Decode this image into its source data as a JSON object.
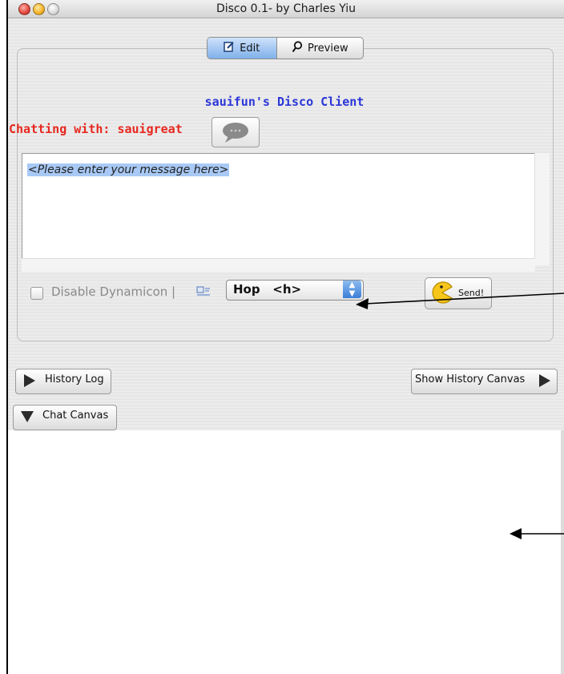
{
  "window": {
    "title": "Disco 0.1- by Charles Yiu"
  },
  "tabs": [
    {
      "label": "Edit",
      "icon": "edit-icon",
      "selected": true
    },
    {
      "label": "Preview",
      "icon": "magnifier-icon",
      "selected": false
    }
  ],
  "chat": {
    "client_title": "sauifun's Disco Client",
    "chatting_with": "Chatting with: sauigreat",
    "message": "<Please enter your message here>"
  },
  "controls": {
    "disable_dynamicon": "Disable Dynamicon |",
    "font_selected": "Hop   <h>",
    "send_label": "Send!"
  },
  "buttons": {
    "history_log": "History Log",
    "show_history_canvas": "Show History Canvas",
    "chat_canvas": "Chat Canvas"
  },
  "colors": {
    "client_title": "#2b36d8",
    "chatting_label": "#e7281f",
    "selection": "#a8c9f5"
  }
}
